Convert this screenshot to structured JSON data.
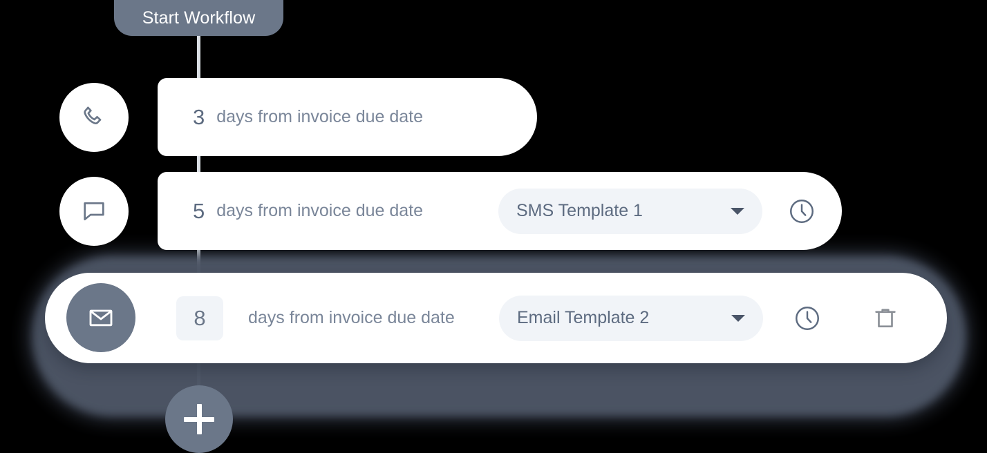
{
  "workflow": {
    "start_label": "Start Workflow",
    "add_step_label": "+",
    "steps": [
      {
        "channel_icon": "phone-icon",
        "days": "3",
        "label": "days from invoice due date",
        "template": null,
        "has_schedule": false,
        "has_delete": false,
        "active": false
      },
      {
        "channel_icon": "chat-bubble-icon",
        "days": "5",
        "label": "days from invoice due date",
        "template": "SMS Template 1",
        "has_schedule": true,
        "has_delete": false,
        "active": false
      },
      {
        "channel_icon": "envelope-icon",
        "days": "8",
        "label": "days from invoice due date",
        "template": "Email Template 2",
        "has_schedule": true,
        "has_delete": true,
        "active": true
      }
    ]
  },
  "colors": {
    "accent_slate": "#6b7789",
    "text_primary": "#5d6b80",
    "text_secondary": "#7a8699",
    "field_bg": "#f1f4f8",
    "card_bg": "#ffffff",
    "canvas_bg": "#000000",
    "connector": "#dadee3"
  }
}
